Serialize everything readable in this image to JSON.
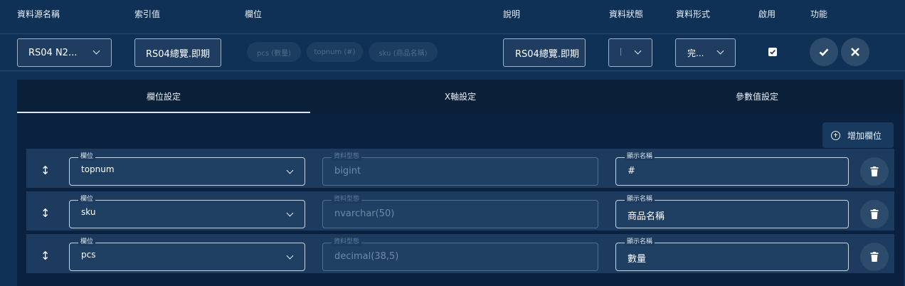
{
  "header": {
    "source": "資料源名稱",
    "index": "索引值",
    "fields": "欄位",
    "desc": "說明",
    "status": "資料狀態",
    "format": "資料形式",
    "enabled": "啟用",
    "actions": "功能"
  },
  "row": {
    "source_value": "RS04 N2...",
    "index_value": "RS04總覽.即期",
    "chips": [
      "pcs (數量)",
      "topnum (#)",
      "sku (商品名稱)"
    ],
    "desc_value": "RS04總覽.即期",
    "status_value": "│",
    "format_value": "完...",
    "enabled_checked": true
  },
  "tabs": [
    "欄位設定",
    "X軸設定",
    "參數值設定"
  ],
  "add_button": "增加欄位",
  "field_rows": [
    {
      "field_label": "欄位",
      "field_value": "topnum",
      "type_label": "資料型態",
      "type_value": "bigint",
      "display_label": "顯示名稱",
      "display_value": "#"
    },
    {
      "field_label": "欄位",
      "field_value": "sku",
      "type_label": "資料型態",
      "type_value": "nvarchar(50)",
      "display_label": "顯示名稱",
      "display_value": "商品名稱"
    },
    {
      "field_label": "欄位",
      "field_value": "pcs",
      "type_label": "資料型態",
      "type_value": "decimal(38,5)",
      "display_label": "顯示名稱",
      "display_value": "數量"
    }
  ],
  "colors": {
    "background": "#0f3155",
    "panel": "#0a223f",
    "row": "#1c3b5e",
    "border": "#9fb2c7",
    "button": "#2d4b6b"
  },
  "icons": {
    "check": "check-icon",
    "close": "close-icon",
    "add": "add-circle-icon",
    "drag": "drag-vertical-icon",
    "delete": "trash-icon",
    "chevron": "chevron-down-icon"
  }
}
